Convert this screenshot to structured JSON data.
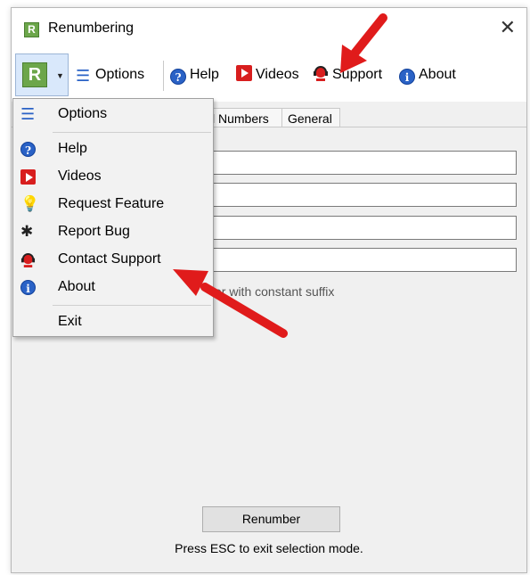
{
  "window": {
    "title": "Renumbering",
    "app_icon_letter": "R",
    "close_glyph": "✕"
  },
  "toolbar": {
    "options_label": "Options",
    "help_label": "Help",
    "videos_label": "Videos",
    "support_label": "Support",
    "about_label": "About"
  },
  "tabs": [
    {
      "label": "l Numbers"
    },
    {
      "label": "General"
    }
  ],
  "form": {
    "hint_text": "er with constant suffix"
  },
  "footer": {
    "renumber_label": "Renumber",
    "status_text": "Press ESC to exit selection mode."
  },
  "menu": {
    "items": [
      {
        "label": "Options",
        "icon": "list-icon"
      },
      {
        "label": "Help",
        "icon": "help-icon"
      },
      {
        "label": "Videos",
        "icon": "video-icon"
      },
      {
        "label": "Request Feature",
        "icon": "lightbulb-icon"
      },
      {
        "label": "Report Bug",
        "icon": "bug-icon"
      },
      {
        "label": "Contact Support",
        "icon": "support-headset-icon"
      },
      {
        "label": "About",
        "icon": "info-icon"
      },
      {
        "label": "Exit",
        "icon": ""
      }
    ]
  },
  "colors": {
    "accent_red": "#e01b1b",
    "app_green": "#6ca64a",
    "info_blue": "#2a62c6"
  }
}
